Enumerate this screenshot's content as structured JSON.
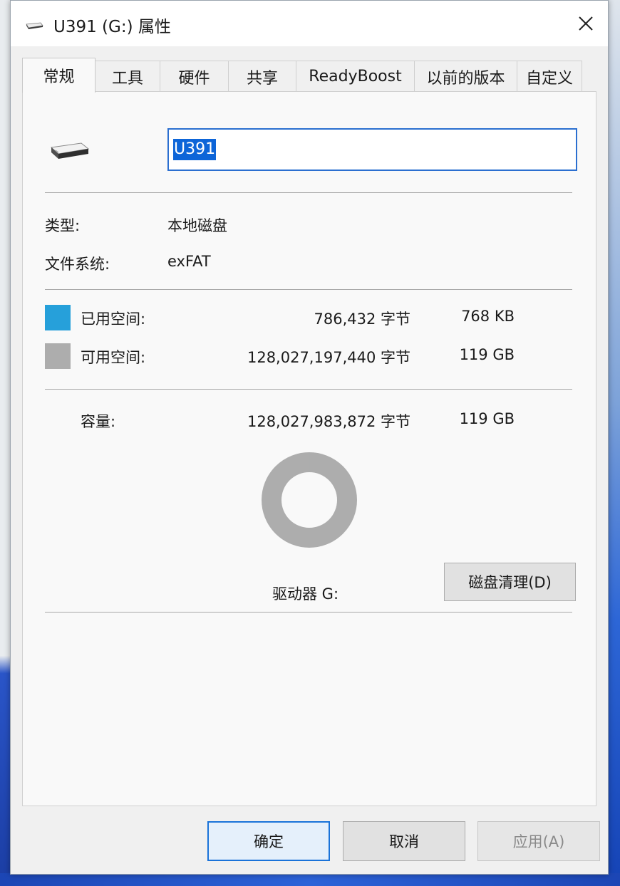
{
  "window": {
    "title": "U391 (G:) 属性"
  },
  "tabs": [
    {
      "label": "常规",
      "active": true
    },
    {
      "label": "工具"
    },
    {
      "label": "硬件"
    },
    {
      "label": "共享"
    },
    {
      "label": "ReadyBoost"
    },
    {
      "label": "以前的版本"
    },
    {
      "label": "自定义"
    }
  ],
  "general": {
    "drive_name": "U391",
    "type_label": "类型:",
    "type_value": "本地磁盘",
    "fs_label": "文件系统:",
    "fs_value": "exFAT",
    "used_label": "已用空间:",
    "used_bytes": "786,432 字节",
    "used_size": "768 KB",
    "free_label": "可用空间:",
    "free_bytes": "128,027,197,440 字节",
    "free_size": "119 GB",
    "capacity_label": "容量:",
    "capacity_bytes": "128,027,983,872 字节",
    "capacity_size": "119 GB",
    "drive_label": "驱动器 G:",
    "cleanup_button": "磁盘清理(D)",
    "used_fraction": 6.1e-06
  },
  "footer": {
    "ok": "确定",
    "cancel": "取消",
    "apply": "应用(A)"
  },
  "colors": {
    "used": "#26a0da",
    "free": "#adadad",
    "accent": "#0d65d8"
  },
  "icons": {
    "close": "close-icon",
    "drive": "usb-drive-icon"
  }
}
